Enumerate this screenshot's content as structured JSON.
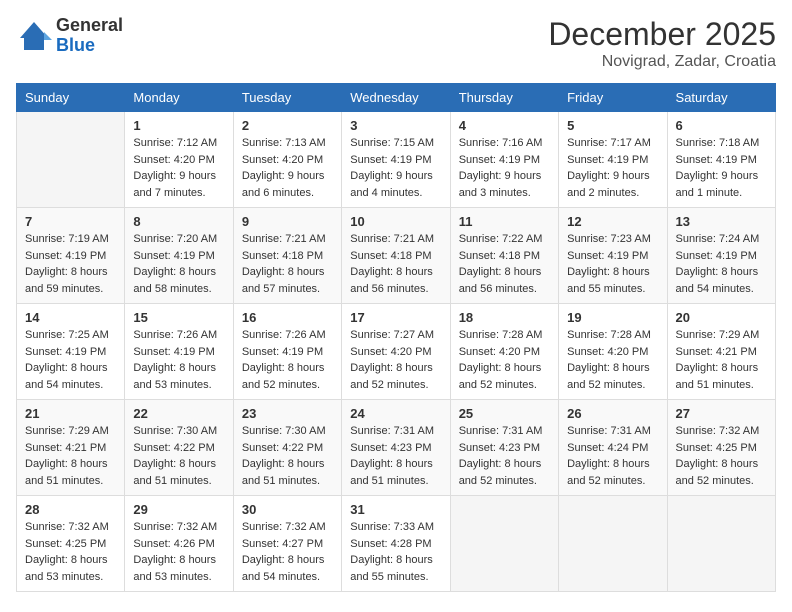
{
  "header": {
    "logo_general": "General",
    "logo_blue": "Blue",
    "month_year": "December 2025",
    "location": "Novigrad, Zadar, Croatia"
  },
  "days_of_week": [
    "Sunday",
    "Monday",
    "Tuesday",
    "Wednesday",
    "Thursday",
    "Friday",
    "Saturday"
  ],
  "weeks": [
    [
      {
        "day": "",
        "sunrise": "",
        "sunset": "",
        "daylight": ""
      },
      {
        "day": "1",
        "sunrise": "Sunrise: 7:12 AM",
        "sunset": "Sunset: 4:20 PM",
        "daylight": "Daylight: 9 hours and 7 minutes."
      },
      {
        "day": "2",
        "sunrise": "Sunrise: 7:13 AM",
        "sunset": "Sunset: 4:20 PM",
        "daylight": "Daylight: 9 hours and 6 minutes."
      },
      {
        "day": "3",
        "sunrise": "Sunrise: 7:15 AM",
        "sunset": "Sunset: 4:19 PM",
        "daylight": "Daylight: 9 hours and 4 minutes."
      },
      {
        "day": "4",
        "sunrise": "Sunrise: 7:16 AM",
        "sunset": "Sunset: 4:19 PM",
        "daylight": "Daylight: 9 hours and 3 minutes."
      },
      {
        "day": "5",
        "sunrise": "Sunrise: 7:17 AM",
        "sunset": "Sunset: 4:19 PM",
        "daylight": "Daylight: 9 hours and 2 minutes."
      },
      {
        "day": "6",
        "sunrise": "Sunrise: 7:18 AM",
        "sunset": "Sunset: 4:19 PM",
        "daylight": "Daylight: 9 hours and 1 minute."
      }
    ],
    [
      {
        "day": "7",
        "sunrise": "Sunrise: 7:19 AM",
        "sunset": "Sunset: 4:19 PM",
        "daylight": "Daylight: 8 hours and 59 minutes."
      },
      {
        "day": "8",
        "sunrise": "Sunrise: 7:20 AM",
        "sunset": "Sunset: 4:19 PM",
        "daylight": "Daylight: 8 hours and 58 minutes."
      },
      {
        "day": "9",
        "sunrise": "Sunrise: 7:21 AM",
        "sunset": "Sunset: 4:18 PM",
        "daylight": "Daylight: 8 hours and 57 minutes."
      },
      {
        "day": "10",
        "sunrise": "Sunrise: 7:21 AM",
        "sunset": "Sunset: 4:18 PM",
        "daylight": "Daylight: 8 hours and 56 minutes."
      },
      {
        "day": "11",
        "sunrise": "Sunrise: 7:22 AM",
        "sunset": "Sunset: 4:18 PM",
        "daylight": "Daylight: 8 hours and 56 minutes."
      },
      {
        "day": "12",
        "sunrise": "Sunrise: 7:23 AM",
        "sunset": "Sunset: 4:19 PM",
        "daylight": "Daylight: 8 hours and 55 minutes."
      },
      {
        "day": "13",
        "sunrise": "Sunrise: 7:24 AM",
        "sunset": "Sunset: 4:19 PM",
        "daylight": "Daylight: 8 hours and 54 minutes."
      }
    ],
    [
      {
        "day": "14",
        "sunrise": "Sunrise: 7:25 AM",
        "sunset": "Sunset: 4:19 PM",
        "daylight": "Daylight: 8 hours and 54 minutes."
      },
      {
        "day": "15",
        "sunrise": "Sunrise: 7:26 AM",
        "sunset": "Sunset: 4:19 PM",
        "daylight": "Daylight: 8 hours and 53 minutes."
      },
      {
        "day": "16",
        "sunrise": "Sunrise: 7:26 AM",
        "sunset": "Sunset: 4:19 PM",
        "daylight": "Daylight: 8 hours and 52 minutes."
      },
      {
        "day": "17",
        "sunrise": "Sunrise: 7:27 AM",
        "sunset": "Sunset: 4:20 PM",
        "daylight": "Daylight: 8 hours and 52 minutes."
      },
      {
        "day": "18",
        "sunrise": "Sunrise: 7:28 AM",
        "sunset": "Sunset: 4:20 PM",
        "daylight": "Daylight: 8 hours and 52 minutes."
      },
      {
        "day": "19",
        "sunrise": "Sunrise: 7:28 AM",
        "sunset": "Sunset: 4:20 PM",
        "daylight": "Daylight: 8 hours and 52 minutes."
      },
      {
        "day": "20",
        "sunrise": "Sunrise: 7:29 AM",
        "sunset": "Sunset: 4:21 PM",
        "daylight": "Daylight: 8 hours and 51 minutes."
      }
    ],
    [
      {
        "day": "21",
        "sunrise": "Sunrise: 7:29 AM",
        "sunset": "Sunset: 4:21 PM",
        "daylight": "Daylight: 8 hours and 51 minutes."
      },
      {
        "day": "22",
        "sunrise": "Sunrise: 7:30 AM",
        "sunset": "Sunset: 4:22 PM",
        "daylight": "Daylight: 8 hours and 51 minutes."
      },
      {
        "day": "23",
        "sunrise": "Sunrise: 7:30 AM",
        "sunset": "Sunset: 4:22 PM",
        "daylight": "Daylight: 8 hours and 51 minutes."
      },
      {
        "day": "24",
        "sunrise": "Sunrise: 7:31 AM",
        "sunset": "Sunset: 4:23 PM",
        "daylight": "Daylight: 8 hours and 51 minutes."
      },
      {
        "day": "25",
        "sunrise": "Sunrise: 7:31 AM",
        "sunset": "Sunset: 4:23 PM",
        "daylight": "Daylight: 8 hours and 52 minutes."
      },
      {
        "day": "26",
        "sunrise": "Sunrise: 7:31 AM",
        "sunset": "Sunset: 4:24 PM",
        "daylight": "Daylight: 8 hours and 52 minutes."
      },
      {
        "day": "27",
        "sunrise": "Sunrise: 7:32 AM",
        "sunset": "Sunset: 4:25 PM",
        "daylight": "Daylight: 8 hours and 52 minutes."
      }
    ],
    [
      {
        "day": "28",
        "sunrise": "Sunrise: 7:32 AM",
        "sunset": "Sunset: 4:25 PM",
        "daylight": "Daylight: 8 hours and 53 minutes."
      },
      {
        "day": "29",
        "sunrise": "Sunrise: 7:32 AM",
        "sunset": "Sunset: 4:26 PM",
        "daylight": "Daylight: 8 hours and 53 minutes."
      },
      {
        "day": "30",
        "sunrise": "Sunrise: 7:32 AM",
        "sunset": "Sunset: 4:27 PM",
        "daylight": "Daylight: 8 hours and 54 minutes."
      },
      {
        "day": "31",
        "sunrise": "Sunrise: 7:33 AM",
        "sunset": "Sunset: 4:28 PM",
        "daylight": "Daylight: 8 hours and 55 minutes."
      },
      {
        "day": "",
        "sunrise": "",
        "sunset": "",
        "daylight": ""
      },
      {
        "day": "",
        "sunrise": "",
        "sunset": "",
        "daylight": ""
      },
      {
        "day": "",
        "sunrise": "",
        "sunset": "",
        "daylight": ""
      }
    ]
  ]
}
